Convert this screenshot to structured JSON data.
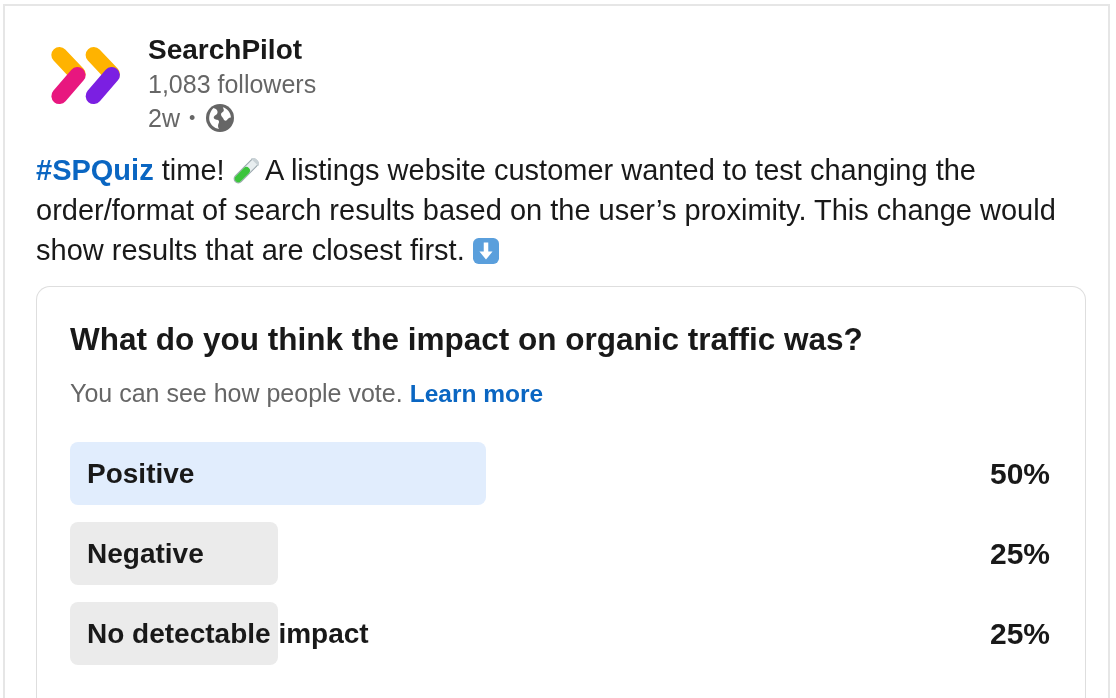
{
  "post": {
    "author": {
      "name": "SearchPilot",
      "followers": "1,083 followers",
      "time": "2w",
      "separator": "•"
    },
    "text": [
      {
        "kind": "hashtag",
        "text": "#SPQuiz"
      },
      {
        "kind": "text",
        "text": "time!"
      },
      {
        "kind": "tube"
      },
      {
        "kind": "text",
        "text": "A listings website customer wanted to test changing the order/format of search results based on the user’s proximity. This change would show results that are closest first."
      },
      {
        "kind": "arrow"
      }
    ],
    "poll": {
      "question": "What do you think the impact on organic traffic was?",
      "note": "You can see how people vote.",
      "link": "Learn more",
      "options": [
        {
          "label": "Positive",
          "share": "50%",
          "level": 0.5,
          "leading": true
        },
        {
          "label": "Negative",
          "share": "25%",
          "level": 0.25,
          "leading": false
        },
        {
          "label": "No detectable impact",
          "share": "25%",
          "level": 0.25,
          "leading": false
        }
      ]
    }
  }
}
